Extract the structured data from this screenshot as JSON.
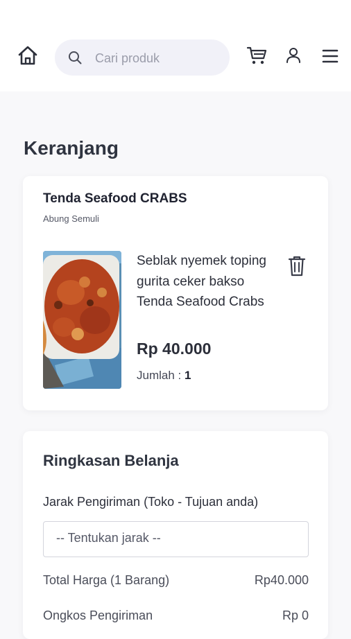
{
  "header": {
    "search_placeholder": "Cari produk"
  },
  "page": {
    "title": "Keranjang"
  },
  "store": {
    "name": "Tenda Seafood CRABS",
    "location": "Abung Semuli",
    "item": {
      "name": "Seblak nyemek toping gurita ceker bakso Tenda Seafood Crabs",
      "price": "Rp 40.000",
      "quantity_label": "Jumlah : ",
      "quantity": "1"
    }
  },
  "summary": {
    "title": "Ringkasan Belanja",
    "distance_label": "Jarak Pengiriman (Toko - Tujuan anda)",
    "distance_select": "-- Tentukan jarak --",
    "total_label": "Total Harga (1 Barang)",
    "total_value": "Rp40.000",
    "shipping_label": "Ongkos Pengiriman",
    "shipping_value": "Rp 0"
  }
}
